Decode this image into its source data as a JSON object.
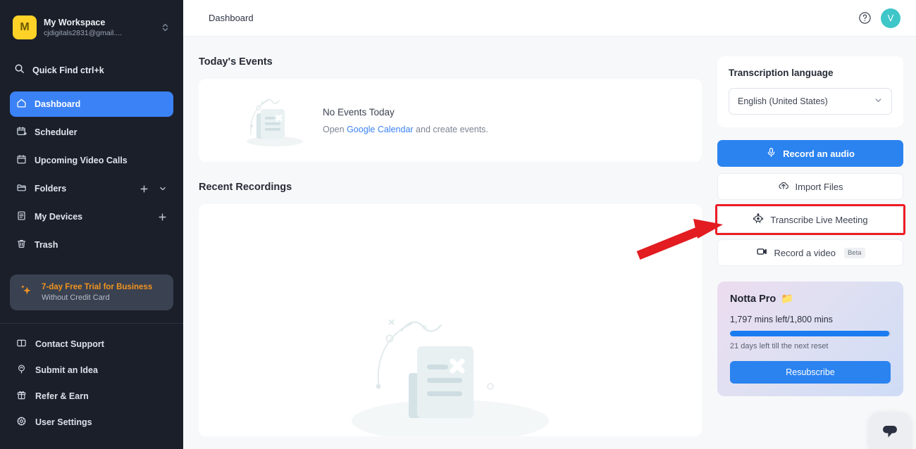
{
  "sidebar": {
    "workspace": {
      "avatar_letter": "M",
      "name": "My Workspace",
      "email": "cjdigitals2831@gmail...."
    },
    "quick_find": {
      "label": "Quick Find ctrl+k"
    },
    "nav_items": [
      {
        "label": "Dashboard",
        "icon": "home-icon",
        "active": true
      },
      {
        "label": "Scheduler",
        "icon": "calendar-add-icon",
        "active": false
      },
      {
        "label": "Upcoming Video Calls",
        "icon": "calendar-icon",
        "active": false
      },
      {
        "label": "Folders",
        "icon": "folder-icon",
        "active": false
      },
      {
        "label": "My Devices",
        "icon": "device-icon",
        "active": false
      },
      {
        "label": "Trash",
        "icon": "trash-icon",
        "active": false
      }
    ],
    "trial": {
      "title": "7-day Free Trial for Business",
      "subtitle": "Without Credit Card"
    },
    "bottom_items": [
      {
        "label": "Contact Support",
        "icon": "message-icon"
      },
      {
        "label": "Submit an Idea",
        "icon": "lightbulb-pin-icon"
      },
      {
        "label": "Refer & Earn",
        "icon": "gift-icon"
      },
      {
        "label": "User Settings",
        "icon": "gear-icon"
      }
    ]
  },
  "topbar": {
    "title": "Dashboard",
    "help_icon": "question-circle-icon",
    "avatar_letter": "V"
  },
  "main": {
    "events_section_title": "Today's Events",
    "events_empty": {
      "headline": "No Events Today",
      "prefix": "Open ",
      "link": "Google Calendar",
      "suffix": " and create events."
    },
    "recordings_section_title": "Recent Recordings"
  },
  "right_panel": {
    "language": {
      "title": "Transcription language",
      "selected": "English (United States)",
      "chevron_icon": "chevron-down-icon"
    },
    "buttons": [
      {
        "label": "Record an audio",
        "icon": "microphone-icon",
        "style": "primary",
        "highlighted": false,
        "badge": ""
      },
      {
        "label": "Import Files",
        "icon": "cloud-upload-icon",
        "style": "ghost",
        "highlighted": false,
        "badge": ""
      },
      {
        "label": "Transcribe Live Meeting",
        "icon": "robot-icon",
        "style": "ghost",
        "highlighted": true,
        "badge": ""
      },
      {
        "label": "Record a video",
        "icon": "video-camera-icon",
        "style": "ghost",
        "highlighted": false,
        "badge": "Beta"
      }
    ],
    "pro_card": {
      "title": "Notta Pro",
      "title_emoji": "📁",
      "minutes": "1,797 mins left/1,800 mins",
      "progress_percent": 99,
      "reset_note": "21 days left till the next reset",
      "cta_label": "Resubscribe"
    }
  },
  "annotations": {
    "arrow_color": "#e21c21",
    "highlight_color": "#ee1c25"
  },
  "chat_widget": {
    "icon": "chat-bubble-icon"
  },
  "colors": {
    "sidebar_bg": "#1b1f2a",
    "accent_blue": "#2b83f0",
    "active_nav": "#3b82f6",
    "avatar_yellow": "#ffd227",
    "avatar_teal": "#3fc6c9",
    "trial_orange": "#f2941f"
  }
}
